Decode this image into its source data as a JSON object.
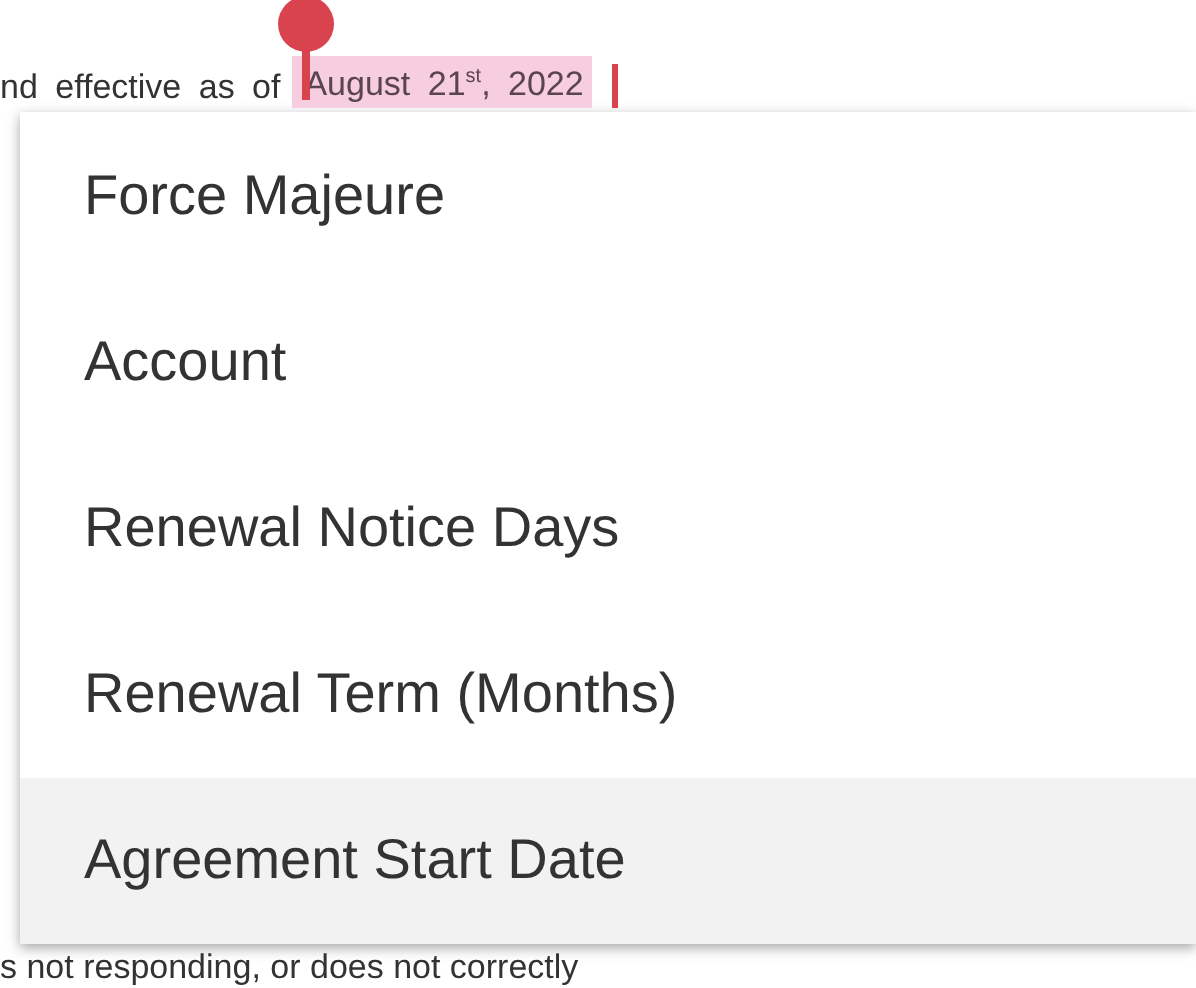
{
  "document": {
    "line_before": "nd effective as of",
    "highlighted_date": "August 21$^{st}$, 2022",
    "line_after": "s not responding, or does not correctly"
  },
  "menu": {
    "items": [
      {
        "label": "Force Majeure",
        "selected": false
      },
      {
        "label": "Account",
        "selected": false
      },
      {
        "label": "Renewal Notice Days",
        "selected": false
      },
      {
        "label": "Renewal Term (Months)",
        "selected": false
      },
      {
        "label": "Agreement Start Date",
        "selected": true
      }
    ]
  }
}
